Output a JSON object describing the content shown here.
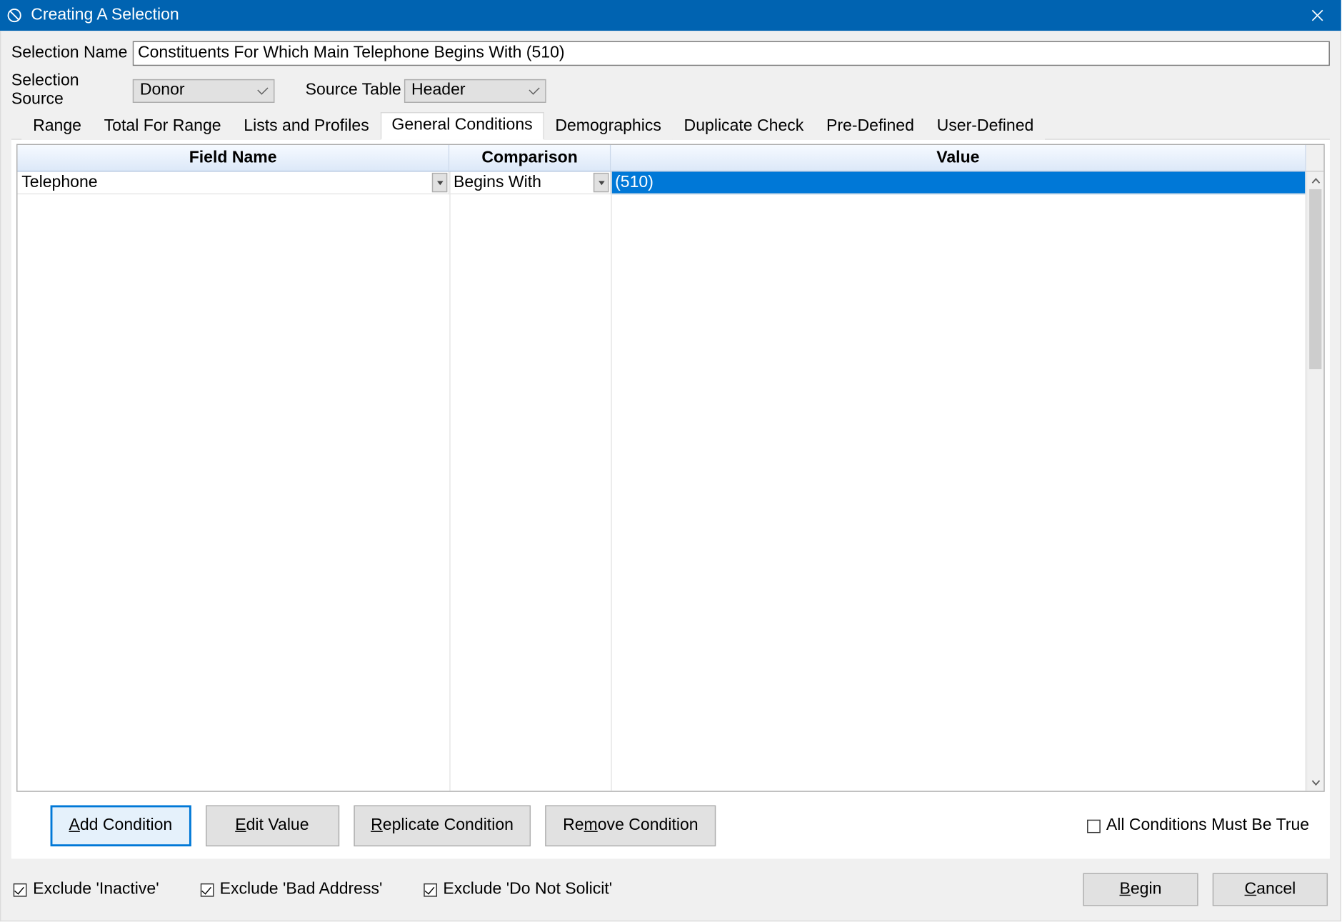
{
  "window": {
    "title": "Creating A Selection"
  },
  "form": {
    "selection_name_label": "Selection Name",
    "selection_name_value": "Constituents For Which Main Telephone Begins With (510)",
    "selection_source_label": "Selection Source",
    "selection_source_value": "Donor",
    "source_table_label": "Source Table",
    "source_table_value": "Header"
  },
  "tabs": [
    {
      "label": "Range"
    },
    {
      "label": "Total For Range"
    },
    {
      "label": "Lists and Profiles"
    },
    {
      "label": "General Conditions"
    },
    {
      "label": "Demographics"
    },
    {
      "label": "Duplicate Check"
    },
    {
      "label": "Pre-Defined"
    },
    {
      "label": "User-Defined"
    }
  ],
  "active_tab_index": 3,
  "grid": {
    "columns": [
      "Field Name",
      "Comparison",
      "Value"
    ],
    "rows": [
      {
        "field_name": "Telephone",
        "comparison": "Begins With",
        "value": "(510)"
      }
    ]
  },
  "condition_buttons": {
    "add": "Add Condition",
    "edit": "Edit Value",
    "replicate": "Replicate Condition",
    "remove": "Remove Condition",
    "all_true_label": "All Conditions Must Be True",
    "all_true_checked": false
  },
  "footer": {
    "exclude_inactive_label": "Exclude 'Inactive'",
    "exclude_inactive_checked": true,
    "exclude_bad_address_label": "Exclude 'Bad Address'",
    "exclude_bad_address_checked": true,
    "exclude_do_not_solicit_label": "Exclude 'Do Not Solicit'",
    "exclude_do_not_solicit_checked": true,
    "begin_label": "Begin",
    "cancel_label": "Cancel"
  }
}
